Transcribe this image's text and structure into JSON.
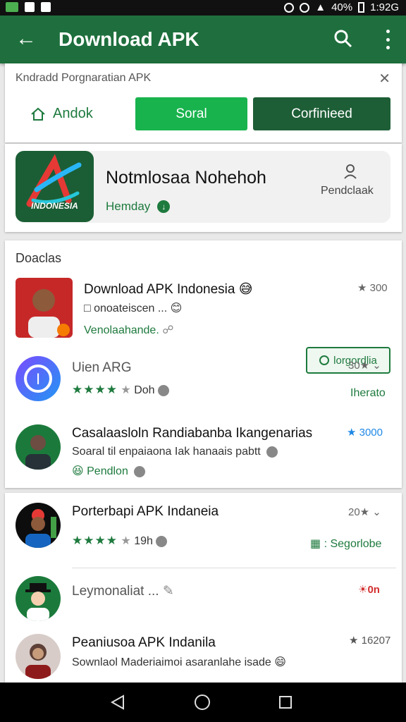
{
  "status_bar": {
    "battery": "40%",
    "time": "1:92G"
  },
  "app_bar": {
    "title": "Download APK"
  },
  "filter": {
    "label": "Kndradd Porgnaratian APK",
    "home_label": "Andok",
    "sort_label": "Soral",
    "confirm_label": "Corfinieed"
  },
  "featured": {
    "logo_text": "INDONESIA",
    "title": "Notmlosaa Nohehoh",
    "subtitle": "Hemday",
    "action": "Pendclaak"
  },
  "list": {
    "section_title": "Doaclas",
    "items": [
      {
        "title": "Download APK Indonesia",
        "sub": "onoateiscen ...",
        "meta": "★ 300",
        "green": "Venolaahande.",
        "button": "lorgordlia"
      },
      {
        "title": "Uien ARG",
        "rating_text": "Doh",
        "meta": "30★",
        "green": "Iherato"
      },
      {
        "title": "Casalaasloln Randiabanba Ikangenarias",
        "sub": "Soaral til enpaiaona Iak hanaais pabtt",
        "green": "Pendlon",
        "meta": "★ 3000"
      },
      {
        "title": "Porterbapi APK Indaneia",
        "rating_text": "19h",
        "meta": "20★",
        "green": "Segorlobe"
      },
      {
        "title": "Leymonaliat ...",
        "meta": "☀0n",
        "meta_color": "#d32f2f"
      },
      {
        "title": "Peaniusoa APK Indanila",
        "sub": "Sownlaol Maderiaimoi asaranlahe isade",
        "meta": "★ 16207"
      }
    ]
  },
  "colors": {
    "primary": "#1e6f3d",
    "accent": "#18b34d",
    "dark_button": "#1d5e36"
  }
}
